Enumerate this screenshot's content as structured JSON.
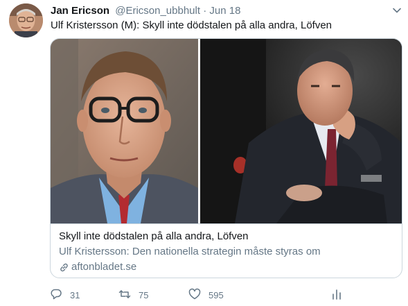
{
  "tweet": {
    "author_name": "Jan Ericson",
    "author_handle": "@Ericson_ubbhult",
    "separator": "·",
    "date": "Jun 18",
    "text": "Ulf Kristersson (M): Skyll inte dödstalen på alla andra, Löfven"
  },
  "card": {
    "title": "Skyll inte dödstalen på alla andra, Löfven",
    "description": "Ulf Kristersson: Den nationella strategin måste styras om",
    "domain": "aftonbladet.se"
  },
  "actions": {
    "replies": "31",
    "retweets": "75",
    "likes": "595"
  },
  "icons": {
    "avatar": "avatar",
    "caret": "chevron-down-icon",
    "link": "link-icon",
    "reply": "reply-icon",
    "retweet": "retweet-icon",
    "like": "heart-icon",
    "analytics": "analytics-icon"
  },
  "colors": {
    "text": "#14171a",
    "muted": "#657786",
    "border": "#ccd6dd"
  }
}
